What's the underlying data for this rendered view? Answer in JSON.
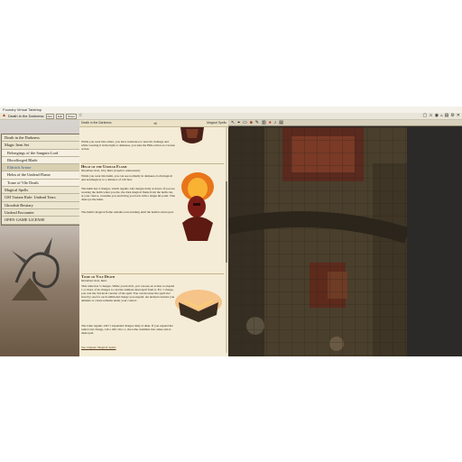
{
  "window": {
    "title": "Foundry Virtual Tabletop"
  },
  "toolbar": {
    "doc_title": "Death in the Darkness",
    "buttons": [
      "Add",
      "Edit",
      "Sheet"
    ],
    "icons": [
      "flame-icon",
      "star-icon",
      "gear-icon",
      "close-icon"
    ]
  },
  "menu": {
    "items": [
      {
        "label": "Death in the Darkness",
        "sub": false
      },
      {
        "label": "Magic Item Set",
        "sub": false
      },
      {
        "label": "Belongings of the Sanguin Lord",
        "sub": true
      },
      {
        "label": "Bloodforged Blade",
        "sub": true
      },
      {
        "label": "Eldritch Armor",
        "sub": true,
        "highlight": true
      },
      {
        "label": "Helm of the Undead Flame",
        "sub": true
      },
      {
        "label": "Tome of Vile Death",
        "sub": true
      },
      {
        "label": "Magical Spells",
        "sub": false
      },
      {
        "label": "GM Variant Rule: Undead Tears",
        "sub": false
      },
      {
        "label": "Ghoulish Bestiary",
        "sub": false
      },
      {
        "label": "Undead Encounter",
        "sub": false
      },
      {
        "label": "OPEN GAME LICENSE",
        "sub": false
      }
    ]
  },
  "doc": {
    "header_left": "Death in the Darkness",
    "header_mid": "≪",
    "header_right": "Magical Spells",
    "intro": "While you wear this armor, you have resistance to necrotic damage and while wearing it in the light or darkness, you take the Hide action as a bonus action.",
    "helm_title": "Helm of the Undead Flame",
    "helm_sub": "Wondrous item, Very Rare (requires attunement)",
    "helm_text_1": "While you wear this helm, you can see normally in darkness, both magical and nonmagical, to a distance of 120 feet.",
    "helm_text_2": "The helm has 3 charges, which regains 1d4 charges daily at dawn. If you are wearing the helm when you die, the dark magical flame from the helm can, at your choice, consume you and bring you back with a single hit point. This destroys the helm.",
    "helm_text_3": "The helm's magical flame remains ever-burning until the helm is destroyed.",
    "tome_title": "Tome of Vile Death",
    "tome_sub": "Wondrous item, Rare",
    "tome_text_1": "This tome has 5 charges. While you hold it, you can use an action to expend 1 or more of its charges to cast the animate dead spell from it. For 1 charge, you cast the 3rd-level version of the spell. You can increase the spell slot level by one for each additional charge you expend. An undead creature you animate or create remains under your control.",
    "tome_text_2": "The tome regains 1d4+1 expended charges daily at dusk. If you expend the tome's last charge, roll a d20. On a 1, the tome crumbles into ashes and is destroyed.",
    "footer_link": "See Chapter: Magical Spells"
  },
  "map_tools": [
    "pointer-icon",
    "target-icon",
    "ruler-icon",
    "tile-icon",
    "draw-icon",
    "wall-icon",
    "light-icon",
    "sound-icon",
    "note-icon"
  ]
}
